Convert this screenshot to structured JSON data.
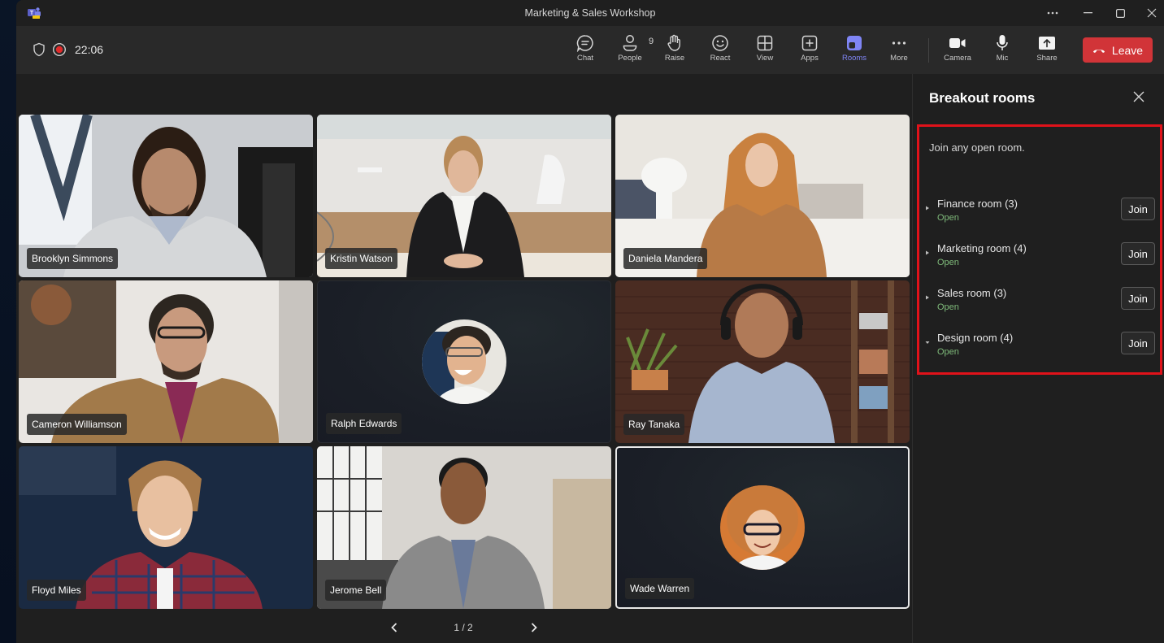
{
  "window": {
    "title": "Marketing & Sales Workshop",
    "controls": {
      "more": "more-options",
      "minimize": "minimize",
      "maximize": "maximize",
      "close": "close"
    }
  },
  "meeting": {
    "timer": "22:06",
    "recording": true,
    "people_count": "9"
  },
  "toolbar": {
    "buttons": [
      {
        "id": "chat",
        "label": "Chat",
        "icon": "chat-icon"
      },
      {
        "id": "people",
        "label": "People",
        "icon": "people-icon"
      },
      {
        "id": "raise",
        "label": "Raise",
        "icon": "raise-hand-icon"
      },
      {
        "id": "react",
        "label": "React",
        "icon": "smiley-icon"
      },
      {
        "id": "view",
        "label": "View",
        "icon": "grid-view-icon"
      },
      {
        "id": "apps",
        "label": "Apps",
        "icon": "add-app-icon"
      },
      {
        "id": "rooms",
        "label": "Rooms",
        "icon": "rooms-icon",
        "active": true
      },
      {
        "id": "more",
        "label": "More",
        "icon": "more-icon"
      },
      {
        "id": "camera",
        "label": "Camera",
        "icon": "camera-icon"
      },
      {
        "id": "mic",
        "label": "Mic",
        "icon": "mic-icon"
      },
      {
        "id": "share",
        "label": "Share",
        "icon": "share-icon"
      }
    ],
    "leave_label": "Leave",
    "active_color": "#7f85f5",
    "leave_color": "#d13438"
  },
  "participants": [
    {
      "name": "Brooklyn Simmons",
      "video": true
    },
    {
      "name": "Kristin Watson",
      "video": true
    },
    {
      "name": "Daniela Mandera",
      "video": true
    },
    {
      "name": "Cameron Williamson",
      "video": true
    },
    {
      "name": "Ralph Edwards",
      "video": false
    },
    {
      "name": "Ray Tanaka",
      "video": true
    },
    {
      "name": "Floyd Miles",
      "video": true
    },
    {
      "name": "Jerome Bell",
      "video": true
    },
    {
      "name": "Wade Warren",
      "video": false,
      "selected": true
    }
  ],
  "pager": {
    "label": "1 / 2"
  },
  "breakout_panel": {
    "title": "Breakout rooms",
    "intro": "Join any open room.",
    "rooms": [
      {
        "name": "Finance room (3)",
        "status": "Open",
        "expanded": false,
        "join_label": "Join"
      },
      {
        "name": "Marketing room (4)",
        "status": "Open",
        "expanded": false,
        "join_label": "Join"
      },
      {
        "name": "Sales room (3)",
        "status": "Open",
        "expanded": false,
        "join_label": "Join"
      },
      {
        "name": "Design room (4)",
        "status": "Open",
        "expanded": true,
        "join_label": "Join"
      }
    ],
    "status_color": "#7fba7a",
    "highlight_color": "#e0121a"
  }
}
